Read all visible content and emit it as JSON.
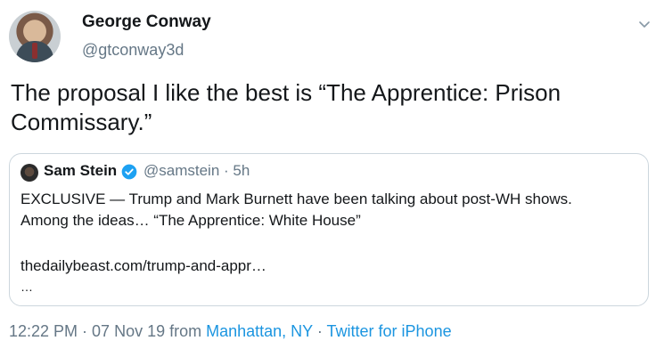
{
  "author": {
    "name": "George Conway",
    "handle": "@gtconway3d"
  },
  "tweet": {
    "text": "The proposal I like the best is “The Apprentice: Prison Commissary.”"
  },
  "quoted": {
    "name": "Sam Stein",
    "handle_time": "@samstein · 5h",
    "text_line1": "EXCLUSIVE — Trump and Mark Burnett have been talking about post-WH shows.",
    "text_line2": "Among the ideas… “The Apprentice: White House”",
    "link": "thedailybeast.com/trump-and-appr…",
    "ellipsis": "…"
  },
  "meta": {
    "time_date": "12:22 PM · 07 Nov 19 from ",
    "location": "Manhattan, NY",
    "separator": " · ",
    "client": "Twitter for iPhone"
  },
  "colors": {
    "link": "#1b95e0",
    "secondary_text": "#657786",
    "border": "#ccd6dd",
    "verified": "#1da1f2"
  },
  "icons": {
    "menu": "chevron-down-icon",
    "verified": "verified-badge-icon"
  }
}
